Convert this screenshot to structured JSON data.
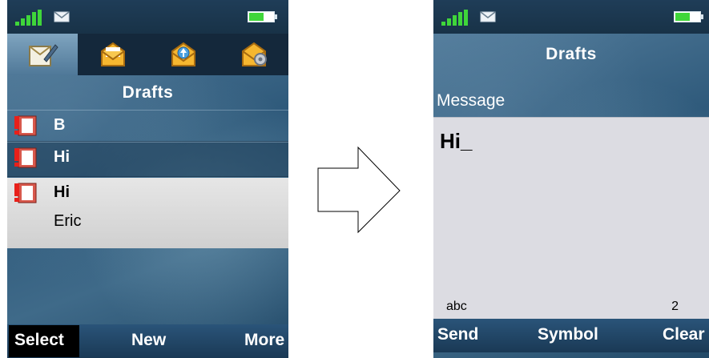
{
  "left_screen": {
    "title": "Drafts",
    "tabs": [
      {
        "icon": "compose-icon"
      },
      {
        "icon": "inbox-envelope-icon"
      },
      {
        "icon": "outbox-upload-icon"
      },
      {
        "icon": "settings-envelope-icon"
      }
    ],
    "drafts": [
      {
        "subject": "B",
        "recipient": ""
      },
      {
        "subject": "Hi",
        "recipient": ""
      },
      {
        "subject": "Hi",
        "recipient": "Eric"
      }
    ],
    "softkeys": {
      "left": "Select",
      "center": "New",
      "right": "More"
    }
  },
  "right_screen": {
    "title": "Drafts",
    "field_label": "Message",
    "message_text": "Hi_",
    "input_mode": "abc",
    "char_count": "2",
    "softkeys": {
      "left": "Send",
      "center": "Symbol",
      "right": "Clear"
    }
  },
  "colors": {
    "signal": "#3fd63a",
    "status_bar": "#1f3d58",
    "softkey_bar": "#2a5479",
    "selected_row": "#dcdcdc",
    "editor_bg": "#dcdce2"
  }
}
